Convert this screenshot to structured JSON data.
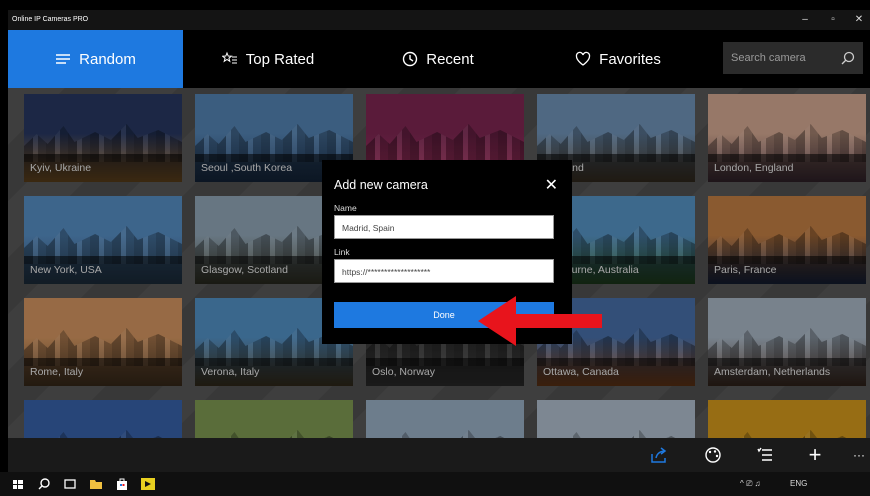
{
  "titlebar": {
    "title": "Online IP Cameras PRO",
    "minimize": "–",
    "maximize": "▫",
    "close": "✕"
  },
  "nav": {
    "tabs": [
      {
        "label": "Random",
        "icon": "menu-lines-icon",
        "active": true
      },
      {
        "label": "Top Rated",
        "icon": "star-list-icon",
        "active": false
      },
      {
        "label": "Recent",
        "icon": "clock-icon",
        "active": false
      },
      {
        "label": "Favorites",
        "icon": "heart-icon",
        "active": false
      }
    ],
    "search": {
      "placeholder": "Search camera",
      "icon": "search-icon"
    }
  },
  "cameras": [
    {
      "label": "Kyiv, Ukraine",
      "sky": "#2b3d6b",
      "ground": "#c98b3b"
    },
    {
      "label": "Seoul ,South Korea",
      "sky": "#5b8fc4",
      "ground": "#2a4d7a"
    },
    {
      "label": "",
      "sky": "#8a2a5a",
      "ground": "#c13b6f"
    },
    {
      "label": "Scotland",
      "sky": "#7aa0c8",
      "ground": "#6e5a40"
    },
    {
      "label": "London, England",
      "sky": "#e9b9a0",
      "ground": "#6a4a5a"
    },
    {
      "label": "New York, USA",
      "sky": "#5f9bd6",
      "ground": "#3d5f80"
    },
    {
      "label": "Glasgow, Scotland",
      "sky": "#9fb6c8",
      "ground": "#5a5a44"
    },
    {
      "label": "",
      "sky": "#1a1a1a",
      "ground": "#2a2a2a"
    },
    {
      "label": "Melbourne, Australia",
      "sky": "#5fa2d8",
      "ground": "#3c7a3a"
    },
    {
      "label": "Paris, France",
      "sky": "#d58a4a",
      "ground": "#2a3d6a"
    },
    {
      "label": "Rome, Italy",
      "sky": "#e8a46a",
      "ground": "#7a5a3a"
    },
    {
      "label": "Verona, Italy",
      "sky": "#5a9ed8",
      "ground": "#6a5a3a"
    },
    {
      "label": "Oslo, Norway",
      "sky": "#3c3c3c",
      "ground": "#5a5a5a"
    },
    {
      "label": "Ottawa, Canada",
      "sky": "#4f7ab8",
      "ground": "#c86a2a"
    },
    {
      "label": "Amsterdam, Netherlands",
      "sky": "#b8c8d8",
      "ground": "#6a4a3a"
    },
    {
      "label": "",
      "sky": "#3c6ab8",
      "ground": "#2a4070"
    },
    {
      "label": "",
      "sky": "#8aa85a",
      "ground": "#c8a040"
    },
    {
      "label": "",
      "sky": "#a8c0d8",
      "ground": "#8a6a4a"
    },
    {
      "label": "",
      "sky": "#c0d0e0",
      "ground": "#9ab0c8"
    },
    {
      "label": "",
      "sky": "#e8a820",
      "ground": "#b87a10"
    }
  ],
  "dialog": {
    "title": "Add new camera",
    "close": "✕",
    "name_label": "Name",
    "name_value": "Madrid, Spain",
    "link_label": "Link",
    "link_value": "https://*******************",
    "done_label": "Done"
  },
  "bottombar": {
    "icons": [
      "share-icon",
      "palette-icon",
      "list-settings-icon",
      "add-icon",
      "more-icon"
    ],
    "add_glyph": "+",
    "more_glyph": "···"
  },
  "taskbar": {
    "language": "ENG",
    "tray_glyph": "^ ⎚ ♫"
  },
  "colors": {
    "accent": "#1e79e0",
    "arrow": "#e8141c",
    "nav_bg": "#000000"
  }
}
